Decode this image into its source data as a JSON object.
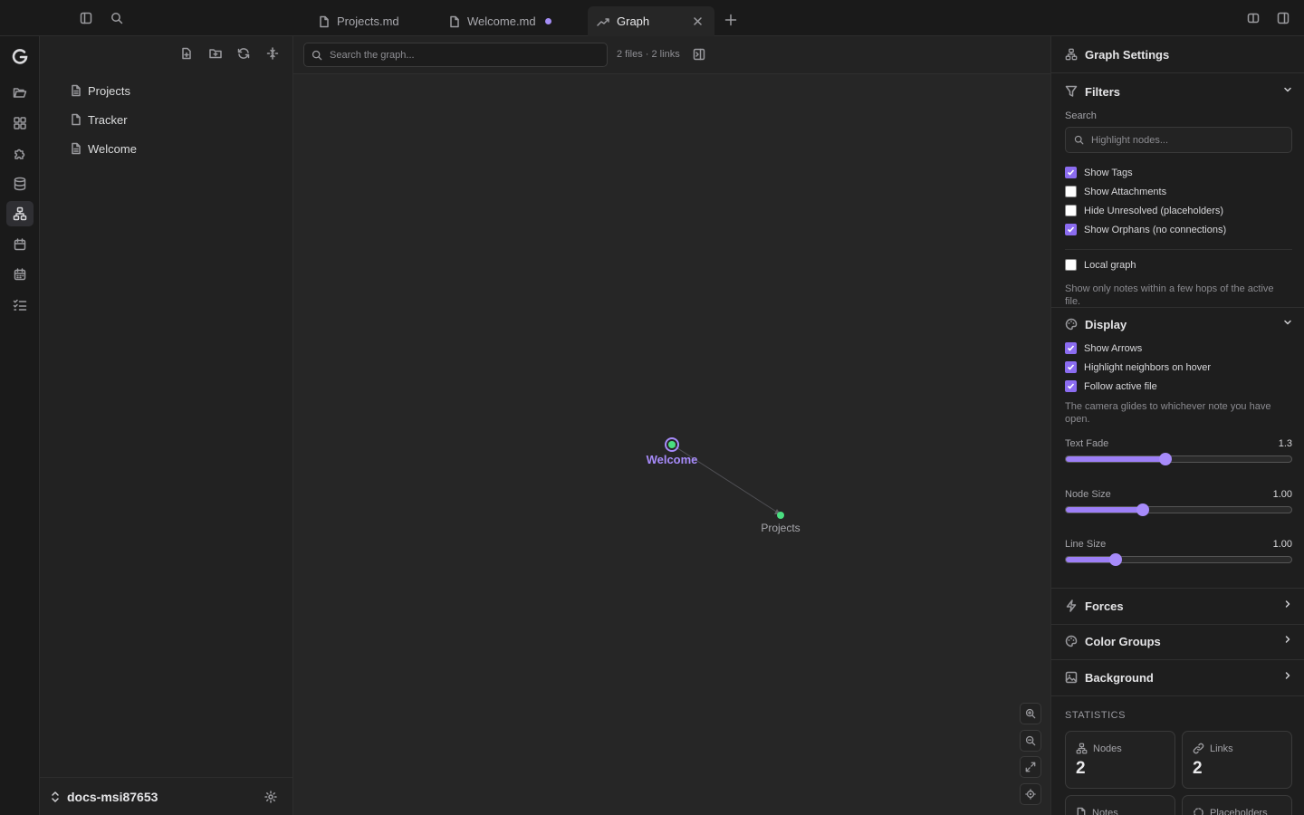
{
  "tabs": [
    {
      "label": "Projects.md",
      "active": false,
      "modified": false
    },
    {
      "label": "Welcome.md",
      "active": false,
      "modified": true
    },
    {
      "label": "Graph",
      "active": true,
      "modified": false
    }
  ],
  "explorer": {
    "files": [
      "Projects",
      "Tracker",
      "Welcome"
    ],
    "vault_name": "docs-msi87653"
  },
  "graph": {
    "search_placeholder": "Search the graph...",
    "stats_text": "2 files · 2 links",
    "nodes": [
      {
        "label": "Welcome",
        "highlighted": true
      },
      {
        "label": "Projects",
        "highlighted": false
      }
    ]
  },
  "settings": {
    "title": "Graph Settings",
    "filters": {
      "title": "Filters",
      "search_label": "Search",
      "search_placeholder": "Highlight nodes...",
      "options": [
        {
          "label": "Show Tags",
          "checked": true
        },
        {
          "label": "Show Attachments",
          "checked": false
        },
        {
          "label": "Hide Unresolved (placeholders)",
          "checked": false
        },
        {
          "label": "Show Orphans (no connections)",
          "checked": true
        }
      ],
      "local_graph": {
        "label": "Local graph",
        "checked": false
      },
      "local_hint": "Show only notes within a few hops of the active file."
    },
    "display": {
      "title": "Display",
      "options": [
        {
          "label": "Show Arrows",
          "checked": true
        },
        {
          "label": "Highlight neighbors on hover",
          "checked": true
        },
        {
          "label": "Follow active file",
          "checked": true
        }
      ],
      "follow_hint": "The camera glides to whichever note you have open.",
      "sliders": [
        {
          "label": "Text Fade",
          "value": "1.3",
          "fraction": 0.44
        },
        {
          "label": "Node Size",
          "value": "1.00",
          "fraction": 0.34
        },
        {
          "label": "Line Size",
          "value": "1.00",
          "fraction": 0.22
        }
      ]
    },
    "collapsed_sections": [
      "Forces",
      "Color Groups",
      "Background"
    ],
    "statistics": {
      "title": "STATISTICS",
      "cards": [
        {
          "label": "Nodes",
          "value": "2"
        },
        {
          "label": "Links",
          "value": "2"
        },
        {
          "label": "Notes",
          "value": ""
        },
        {
          "label": "Placeholders",
          "value": ""
        }
      ]
    }
  },
  "colors": {
    "accent": "#a78bfa",
    "node_green": "#4ade80"
  }
}
